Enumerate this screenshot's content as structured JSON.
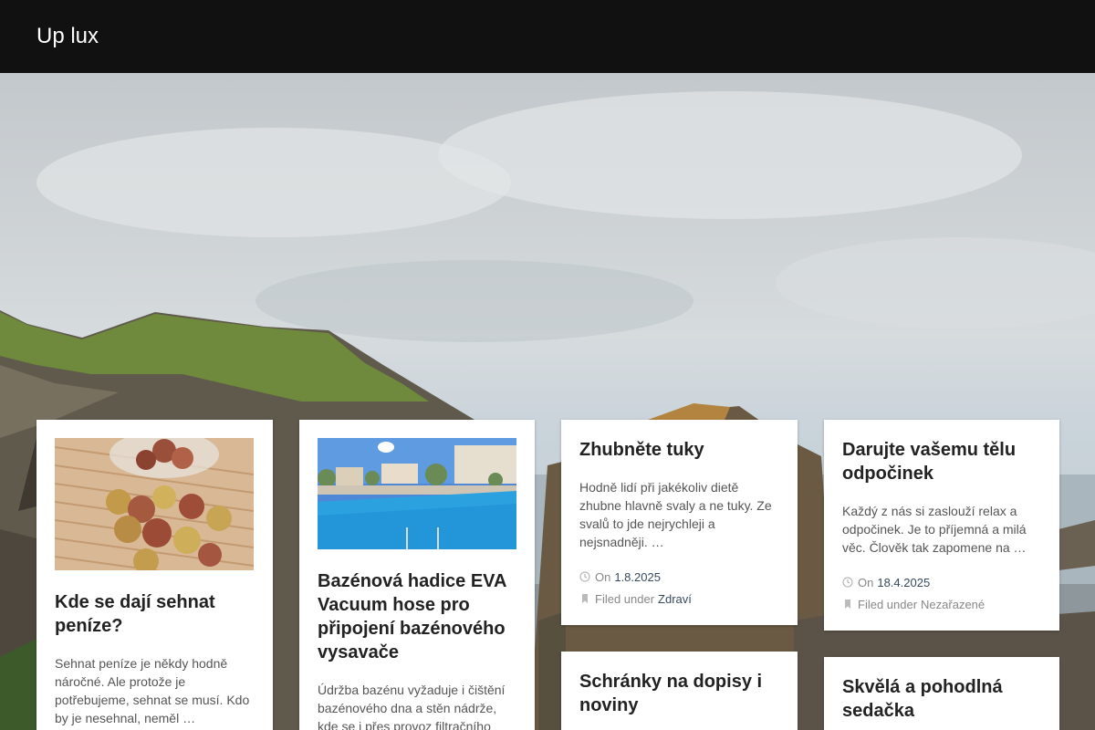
{
  "site": {
    "title": "Up lux"
  },
  "posts": [
    {
      "title": "Kde se dají sehnat peníze?",
      "excerpt": "Sehnat peníze je někdy hodně náročné. Ale protože je potřebujeme, sehnat se musí. Kdo by je nesehnal, neměl …",
      "image": "coins-jar"
    },
    {
      "title": "Bazénová hadice EVA Vacuum hose pro připojení bazénového vysavače",
      "excerpt": "Údržba bazénu vyžaduje i čištění bazénového dna a stěn nádrže, kde se i přes provoz filtračního",
      "image": "swimming-pool"
    },
    {
      "title": "Zhubněte tuky",
      "excerpt": "Hodně lidí při jakékoliv dietě zhubne hlavně svaly a ne tuky. Ze svalů to jde nejrychleji a nejsnadněji. …",
      "date_prefix": "On",
      "date": "1.8.2025",
      "filed_prefix": "Filed under",
      "category": "Zdraví"
    },
    {
      "title": "Darujte vašemu tělu odpočinek",
      "excerpt": "Každý z nás si zaslouží relax a odpočinek. Je to příjemná a milá věc. Člověk tak zapomene na …",
      "date_prefix": "On",
      "date": "18.4.2025",
      "filed_prefix": "Filed under",
      "category": "Nezařazené"
    },
    {
      "title": "Schránky na dopisy i noviny"
    },
    {
      "title": "Skvělá a pohodlná sedačka"
    }
  ],
  "icons": {
    "date": "clock-icon",
    "category": "bookmark-icon"
  },
  "colors": {
    "header_bg": "#111111",
    "link": "#364a5d",
    "meta": "#888888"
  }
}
